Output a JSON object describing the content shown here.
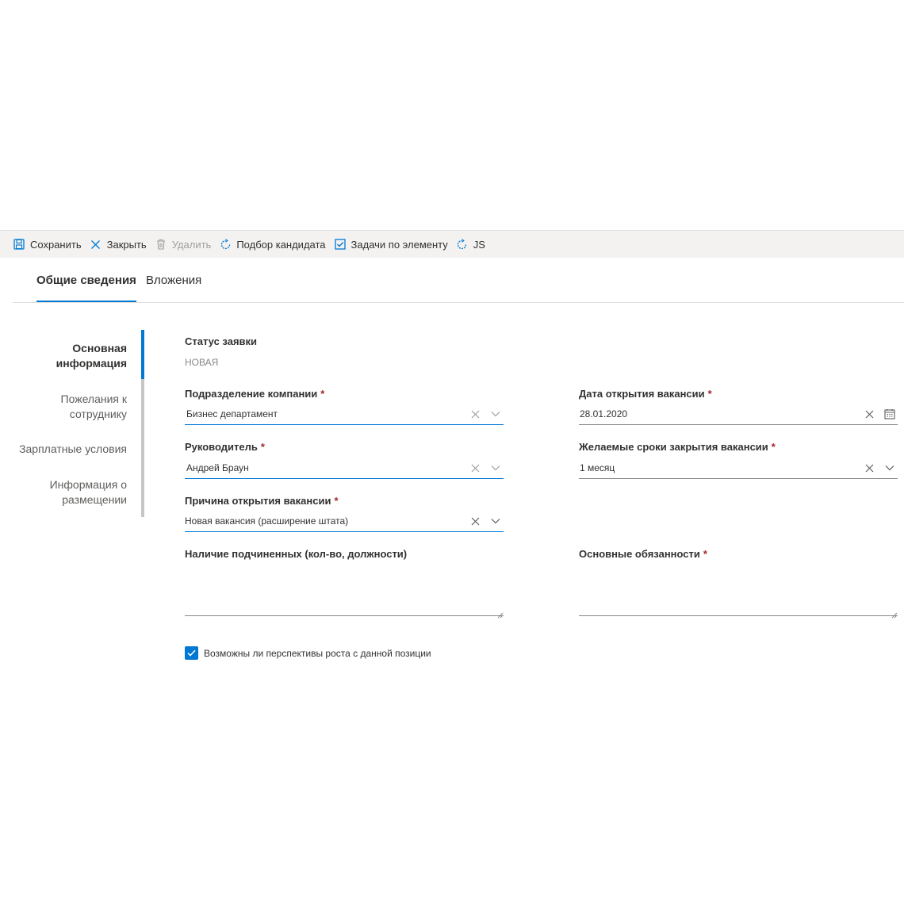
{
  "toolbar": {
    "save_label": "Сохранить",
    "close_label": "Закрыть",
    "delete_label": "Удалить",
    "candidate_label": "Подбор кандидата",
    "tasks_label": "Задачи по элементу",
    "js_label": "JS"
  },
  "tabs": [
    {
      "label": "Общие сведения"
    },
    {
      "label": "Вложения"
    }
  ],
  "side_nav": {
    "items": [
      {
        "line1": "Основная",
        "line2": "информация"
      },
      {
        "line1": "Пожелания к",
        "line2": "сотруднику"
      },
      {
        "line1": "Зарплатные условия",
        "line2": ""
      },
      {
        "line1": "Информация о",
        "line2": "размещении"
      }
    ]
  },
  "form": {
    "status_label": "Статус заявки",
    "status_value": "НОВАЯ",
    "department_label": "Подразделение компании",
    "department_value": "Бизнес департамент",
    "open_date_label": "Дата открытия вакансии",
    "open_date_value": "28.01.2020",
    "manager_label": "Руководитель",
    "manager_value": "Андрей Браун",
    "deadline_label": "Желаемые сроки закрытия вакансии",
    "deadline_value": "1 месяц",
    "reason_label": "Причина открытия вакансии",
    "reason_value": "Новая вакансия (расширение штата)",
    "subordinates_label": "Наличие подчиненных (кол-во, должности)",
    "duties_label": "Основные обязанности",
    "required_mark": "*",
    "growth_checkbox_label": "Возможны ли перспективы роста с данной позиции",
    "growth_checked": true
  },
  "colors": {
    "accent": "#0078d4",
    "required": "#a4262c",
    "toolbar_bg": "#f3f2f1"
  },
  "icons": {
    "save": "save-icon",
    "close": "close-icon",
    "delete": "trash-icon",
    "candidate": "sync-icon",
    "tasks": "checkbox-icon",
    "js": "sync-icon"
  }
}
